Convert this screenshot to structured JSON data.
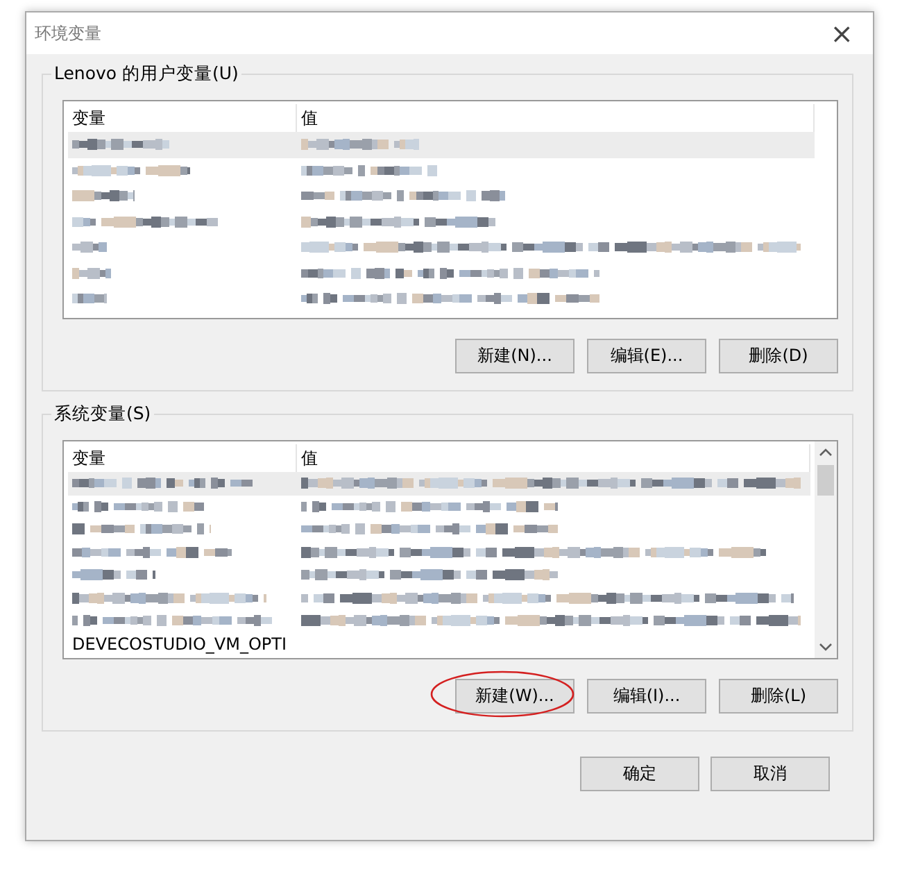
{
  "window": {
    "title": "环境变量",
    "close": "×"
  },
  "user_vars": {
    "title": "Lenovo 的用户变量(U)",
    "columns": [
      "变量",
      "值"
    ],
    "rows": [
      {
        "kind": "blurred",
        "selected": true
      },
      {
        "kind": "blurred",
        "selected": false
      },
      {
        "kind": "blurred",
        "selected": false
      },
      {
        "kind": "blurred",
        "selected": false
      },
      {
        "kind": "blurred",
        "selected": false
      },
      {
        "kind": "blurred",
        "selected": false
      },
      {
        "kind": "blurred",
        "selected": false
      }
    ],
    "buttons": [
      {
        "label": "新建(N)...",
        "annotated": false
      },
      {
        "label": "编辑(E)...",
        "annotated": false
      },
      {
        "label": "删除(D)",
        "annotated": false
      }
    ]
  },
  "system_vars": {
    "title": "系统变量(S)",
    "columns": [
      "变量",
      "值"
    ],
    "rows": [
      {
        "kind": "blurred",
        "selected": true
      },
      {
        "kind": "blurred",
        "selected": false
      },
      {
        "kind": "blurred",
        "selected": false
      },
      {
        "kind": "blurred",
        "selected": false
      },
      {
        "kind": "blurred",
        "selected": false
      },
      {
        "kind": "blurred",
        "selected": false
      },
      {
        "kind": "blurred",
        "selected": false
      },
      {
        "kind": "text",
        "selected": false,
        "name": "DEVECOSTUDIO_VM_OPTI"
      }
    ],
    "buttons": [
      {
        "label": "新建(W)...",
        "annotated": true
      },
      {
        "label": "编辑(I)...",
        "annotated": false
      },
      {
        "label": "删除(L)",
        "annotated": false
      }
    ]
  },
  "footer_buttons": [
    "确定",
    "取消"
  ]
}
